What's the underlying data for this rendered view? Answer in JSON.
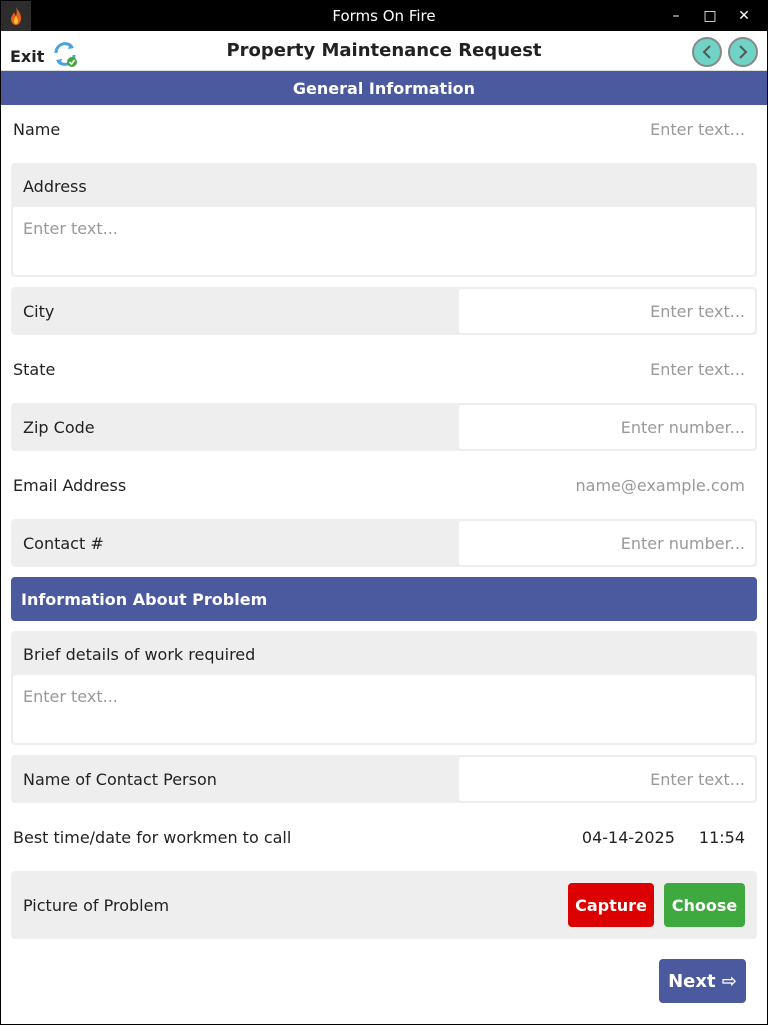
{
  "window": {
    "title": "Forms On Fire"
  },
  "toolbar": {
    "exit_label": "Exit",
    "title": "Property Maintenance Request"
  },
  "sections": {
    "general": "General Information",
    "problem": "Information About Problem"
  },
  "fields": {
    "name": {
      "label": "Name",
      "placeholder": "Enter text..."
    },
    "address": {
      "label": "Address",
      "placeholder": "Enter text..."
    },
    "city": {
      "label": "City",
      "placeholder": "Enter text..."
    },
    "state": {
      "label": "State",
      "placeholder": "Enter text..."
    },
    "zip": {
      "label": "Zip Code",
      "placeholder": "Enter number..."
    },
    "email": {
      "label": "Email Address",
      "placeholder": "name@example.com"
    },
    "contact": {
      "label": "Contact #",
      "placeholder": "Enter number..."
    },
    "details": {
      "label": "Brief details of work required",
      "placeholder": "Enter text..."
    },
    "contact_person": {
      "label": "Name of Contact Person",
      "placeholder": "Enter text..."
    },
    "best_time": {
      "label": "Best time/date for workmen to call",
      "date": "04-14-2025",
      "time": "11:54"
    },
    "picture": {
      "label": "Picture of Problem",
      "capture_label": "Capture",
      "choose_label": "Choose"
    }
  },
  "footer": {
    "next_label": "Next ⇨"
  },
  "icons": [
    "flame-icon",
    "sync-icon",
    "minimize-icon",
    "maximize-icon",
    "close-icon",
    "arrow-left-icon",
    "arrow-right-icon"
  ],
  "colors": {
    "accent": "#4b5a9f",
    "capture": "#dd0000",
    "choose": "#3ea93e",
    "field_bg": "#eeeeee"
  }
}
